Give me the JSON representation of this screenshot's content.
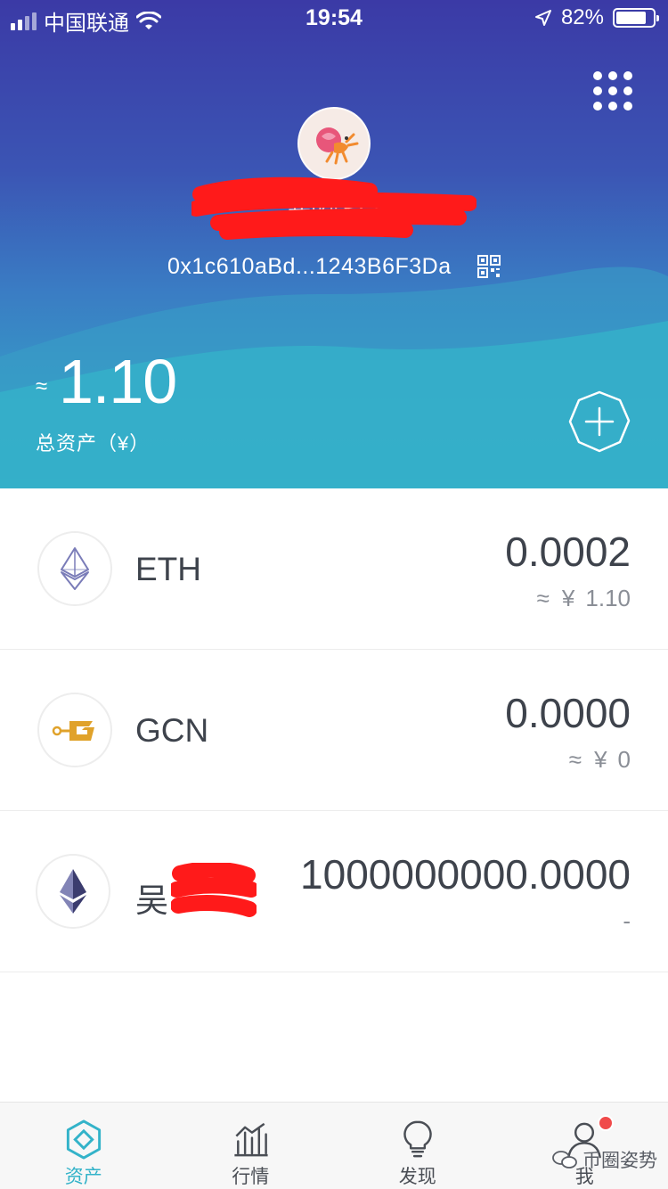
{
  "status_bar": {
    "carrier": "中国联通",
    "time": "19:54",
    "battery": "82%",
    "battery_level": 0.82
  },
  "wallet": {
    "name": "我的钱包",
    "address": "0x1c610aBd...1243B6F3Da"
  },
  "total": {
    "approx": "≈",
    "value": "1.10",
    "label": "总资产（¥）"
  },
  "tokens": [
    {
      "symbol": "ETH",
      "amount": "0.0002",
      "approx": "≈",
      "cny": "¥",
      "fiat": "1.10",
      "icon": "eth-icon"
    },
    {
      "symbol": "GCN",
      "amount": "0.0000",
      "approx": "≈",
      "cny": "¥",
      "fiat": "0",
      "icon": "gcn-icon"
    },
    {
      "symbol": "吴",
      "amount": "1000000000.0000",
      "fiat": "-",
      "icon": "eth-icon"
    }
  ],
  "tabs": [
    {
      "label": "资产",
      "icon": "assets-icon",
      "active": true
    },
    {
      "label": "行情",
      "icon": "market-icon"
    },
    {
      "label": "发现",
      "icon": "bulb-icon"
    },
    {
      "label": "我",
      "icon": "user-icon",
      "badge": true
    }
  ],
  "watermark": "币圈姿势",
  "colors": {
    "hero_top": "#3b3aa6",
    "hero_bottom": "#33b3c9",
    "accent": "#33b3c9",
    "badge": "#f04a4a",
    "redaction": "#ff1a1a"
  }
}
